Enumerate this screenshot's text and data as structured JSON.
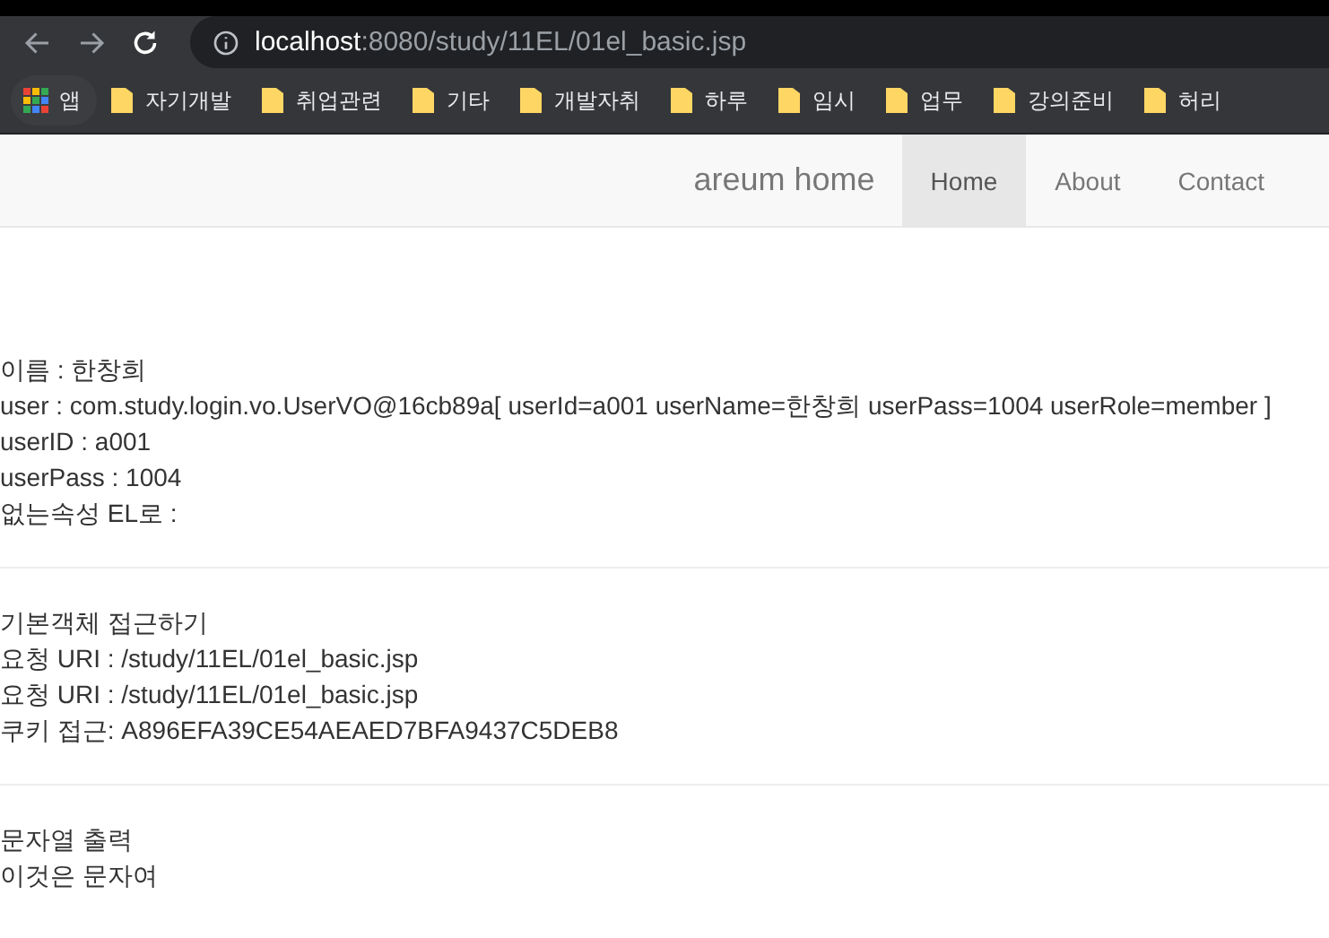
{
  "browser": {
    "url_host": "localhost",
    "url_path": ":8080/study/11EL/01el_basic.jsp",
    "bookmarks": [
      {
        "kind": "apps",
        "label": "앱"
      },
      {
        "kind": "folder",
        "label": "자기개발"
      },
      {
        "kind": "folder",
        "label": "취업관련"
      },
      {
        "kind": "folder",
        "label": "기타"
      },
      {
        "kind": "folder",
        "label": "개발자취"
      },
      {
        "kind": "folder",
        "label": "하루"
      },
      {
        "kind": "folder",
        "label": "임시"
      },
      {
        "kind": "folder",
        "label": "업무"
      },
      {
        "kind": "folder",
        "label": "강의준비"
      },
      {
        "kind": "folder",
        "label": "허리"
      }
    ]
  },
  "navbar": {
    "brand": "areum home",
    "items": [
      {
        "label": "Home",
        "selected": true
      },
      {
        "label": "About",
        "selected": false
      },
      {
        "label": "Contact",
        "selected": false
      }
    ]
  },
  "sections": [
    {
      "lines": [
        "이름 : 한창희",
        "user : com.study.login.vo.UserVO@16cb89a[ userId=a001 userName=한창희 userPass=1004 userRole=member ]",
        "userID : a001",
        "userPass : 1004",
        "없는속성 EL로 :"
      ]
    },
    {
      "lines": [
        "기본객체 접근하기",
        "요청 URI : /study/11EL/01el_basic.jsp",
        "요청 URI : /study/11EL/01el_basic.jsp",
        "쿠키 접근: A896EFA39CE54AEAED7BFA9437C5DEB8"
      ]
    },
    {
      "lines": [
        "문자열 출력",
        "이것은 문자여"
      ]
    }
  ]
}
